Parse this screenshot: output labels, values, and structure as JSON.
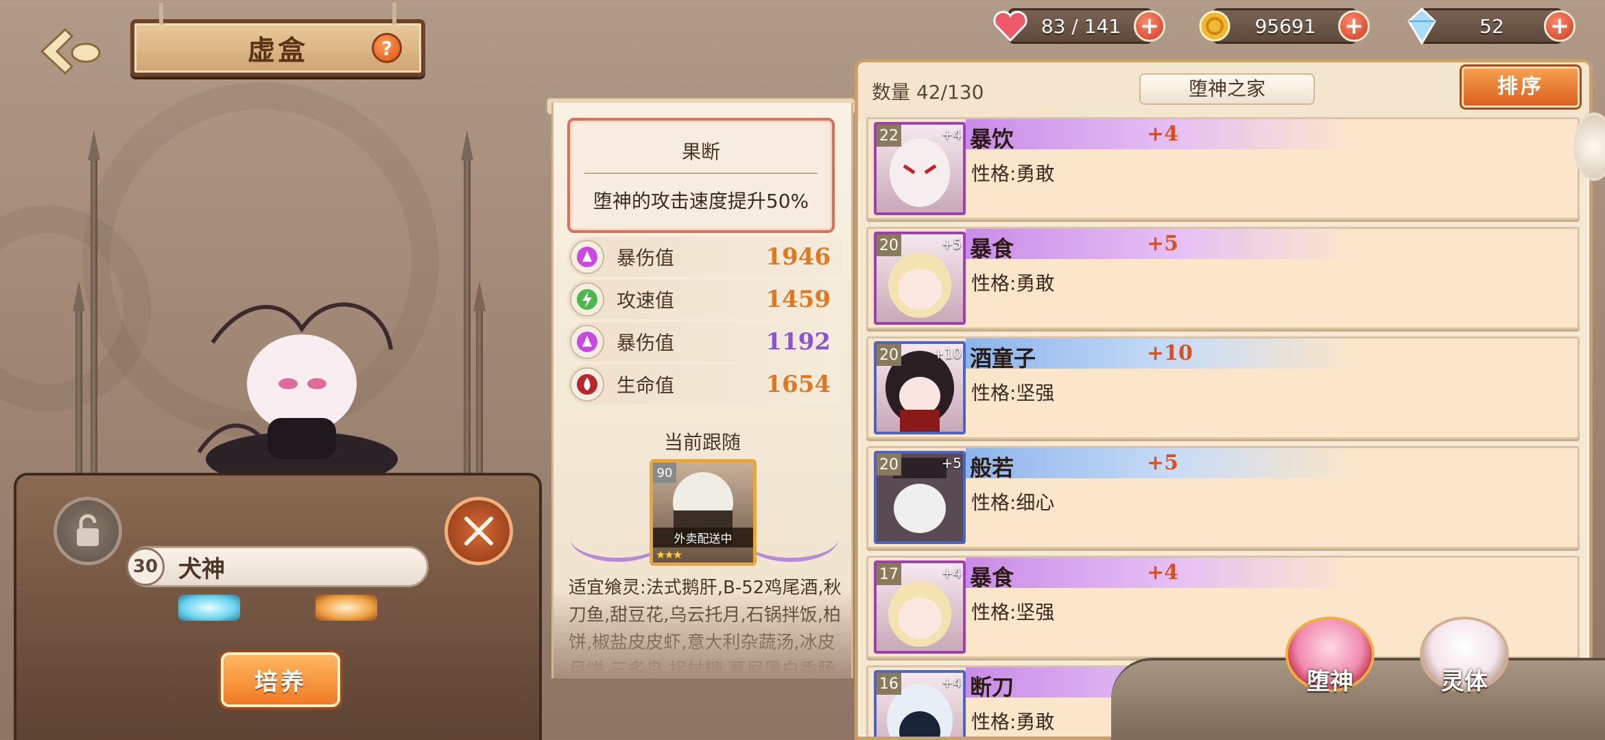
{
  "header": {
    "title": "虚盒",
    "help_symbol": "?"
  },
  "resources": [
    {
      "name": "stamina",
      "icon": "heart-icon",
      "value": "83 / 141",
      "color": "#ef5a6a"
    },
    {
      "name": "gold",
      "icon": "coin-icon",
      "value": "95691",
      "color": "#f2b632"
    },
    {
      "name": "crystal",
      "icon": "crystal-icon",
      "value": "52",
      "color": "#7ac6f0"
    }
  ],
  "character": {
    "level": "30",
    "name": "犬神",
    "train_label": "培养"
  },
  "skill": {
    "title": "果断",
    "description": "堕神的攻击速度提升50%"
  },
  "stats": [
    {
      "label": "暴伤值",
      "value": "1946",
      "color": "#e0781e",
      "icon": "crit-damage-icon"
    },
    {
      "label": "攻速值",
      "value": "1459",
      "color": "#e0781e",
      "icon": "attack-speed-icon"
    },
    {
      "label": "暴伤值",
      "value": "1192",
      "color": "#8a54d6",
      "icon": "crit-damage-icon"
    },
    {
      "label": "生命值",
      "value": "1654",
      "color": "#e0781e",
      "icon": "health-icon"
    }
  ],
  "follow": {
    "label": "当前跟随",
    "level": "90",
    "status": "外卖配送中",
    "stars": "★★★"
  },
  "suitable_text": "适宜飨灵:法式鹅肝,B-52鸡尾酒,秋刀鱼,甜豆花,乌云托月,石锅拌饭,柏饼,椒盐皮皮虾,意大利杂蔬汤,冰皮月饼,三炙鸟,拐杖糖,慕尼黑白香肠,金华火腿,稻荷寿司,啤酒,莫吉托",
  "roster": {
    "count_label": "数量 42/130",
    "house_label": "堕神之家",
    "sort_label": "排序",
    "items": [
      {
        "level": "22",
        "plus": "+4",
        "name": "暴饮",
        "bonus": "+4",
        "trait": "性格:勇敢",
        "frame": "purple"
      },
      {
        "level": "20",
        "plus": "+5",
        "name": "暴食",
        "bonus": "+5",
        "trait": "性格:勇敢",
        "frame": "purple"
      },
      {
        "level": "20",
        "plus": "+10",
        "name": "酒童子",
        "bonus": "+10",
        "trait": "性格:坚强",
        "frame": "blue"
      },
      {
        "level": "20",
        "plus": "+5",
        "name": "般若",
        "bonus": "+5",
        "trait": "性格:细心",
        "frame": "blue"
      },
      {
        "level": "17",
        "plus": "+4",
        "name": "暴食",
        "bonus": "+4",
        "trait": "性格:坚强",
        "frame": "purple"
      },
      {
        "level": "16",
        "plus": "+4",
        "name": "断刀",
        "bonus": "",
        "trait": "性格:勇敢",
        "frame": "blue"
      }
    ]
  },
  "tabs": [
    {
      "label": "堕神",
      "icon": "fallen-god-bowl-icon"
    },
    {
      "label": "灵体",
      "icon": "spirit-bowl-icon"
    }
  ]
}
